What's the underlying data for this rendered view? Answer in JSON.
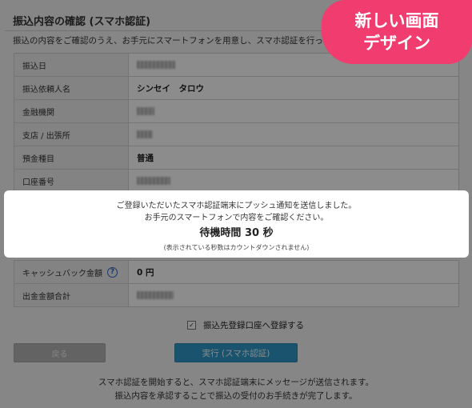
{
  "page": {
    "title": "振込内容の確認 (スマホ認証)",
    "lead": "振込の内容をご確認のうえ、お手元にスマートフォンを用意し、スマホ認証を行ってください。"
  },
  "details_top": [
    {
      "label": "振込日",
      "value": ""
    },
    {
      "label": "振込依頼人名",
      "value": "シンセイ　タロウ"
    },
    {
      "label": "金融機関",
      "value": ""
    },
    {
      "label": "支店 / 出張所",
      "value": ""
    },
    {
      "label": "預金種目",
      "value": "普通"
    },
    {
      "label": "口座番号",
      "value": ""
    }
  ],
  "details_bottom": [
    {
      "label": "キャッシュバック金額",
      "value": "0 円"
    },
    {
      "label": "出金金額合計",
      "value": ""
    }
  ],
  "icons": {
    "help": "?",
    "check": "✓"
  },
  "register_checkbox": {
    "label": "振込先登録口座へ登録する",
    "checked": true
  },
  "buttons": {
    "back": "戻る",
    "execute": "実行 (スマホ認証)"
  },
  "footer_note": {
    "line1": "スマホ認証を開始すると、スマホ認証端末にメッセージが送信されます。",
    "line2": "振込内容を承認することで振込の受付のお手続きが完了します。"
  },
  "modal": {
    "line1": "ご登録いただいたスマホ認証端末にプッシュ通知を送信しました。",
    "line2": "お手元のスマートフォンで内容をご確認ください。",
    "wait_text": "待機時間 30 秒",
    "wait_seconds": 30,
    "note": "(表示されている秒数はカウントダウンされません)"
  },
  "badge": {
    "line1": "新しい画面",
    "line2": "デザイン"
  },
  "colors": {
    "badge": "#f03c6e",
    "execute_button": "#2f98c6",
    "back_button": "#b5b5b5",
    "help_icon": "#2f63c4"
  }
}
